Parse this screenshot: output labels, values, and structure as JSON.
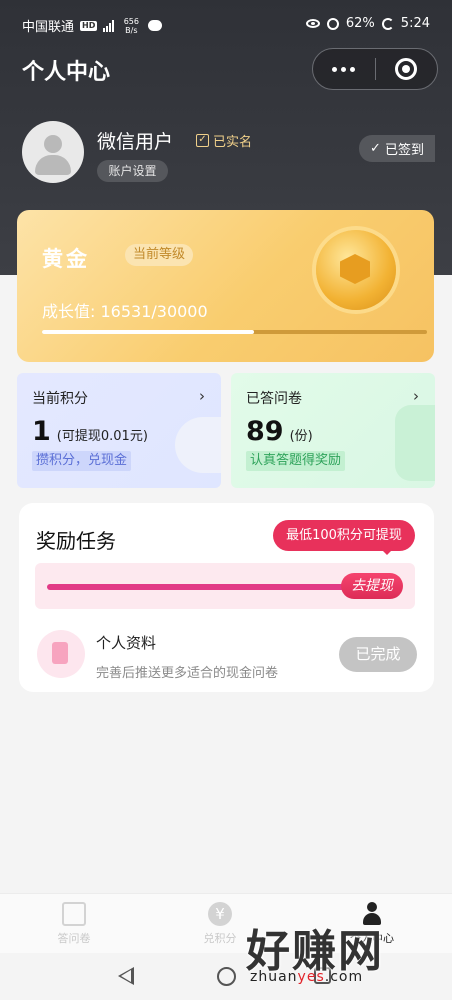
{
  "status_bar": {
    "carrier": "中国联通",
    "hd": "HD",
    "net_speed": "656 B/s",
    "battery": "62%",
    "time": "5:24"
  },
  "page": {
    "title": "个人中心"
  },
  "user": {
    "name": "微信用户",
    "verified_label": "已实名",
    "account_settings_label": "账户设置",
    "checkin_label": "已签到"
  },
  "level": {
    "name": "黄金",
    "tag": "当前等级",
    "growth_text": "成长值:  16531/30000",
    "growth_current": 16531,
    "growth_total": 30000
  },
  "points_card": {
    "label": "当前积分",
    "value": "1",
    "sub": "(可提现0.01元)",
    "tag": "攒积分，兑现金",
    "arrow": "›"
  },
  "survey_card": {
    "label": "已答问卷",
    "value": "89",
    "sub": "(份)",
    "tag": "认真答题得奖励",
    "arrow": "›"
  },
  "tasks": {
    "title": "奖励任务",
    "bubble": "最低100积分可提现",
    "withdraw_label": "去提现",
    "item": {
      "name": "个人资料",
      "desc": "完善后推送更多适合的现金问卷",
      "button": "已完成"
    }
  },
  "tabbar": {
    "items": [
      {
        "label": "答问卷",
        "icon": "survey-icon"
      },
      {
        "label": "兑积分",
        "icon": "yen-icon"
      },
      {
        "label": "个人中心",
        "icon": "user-icon"
      }
    ]
  },
  "watermark": {
    "big": "好赚网",
    "small_a": "zhuan",
    "small_b": "yes",
    "small_c": ".com"
  },
  "colors": {
    "accent": "#e8315b",
    "gold": "#f9cd6f",
    "header": "#2f3137"
  }
}
